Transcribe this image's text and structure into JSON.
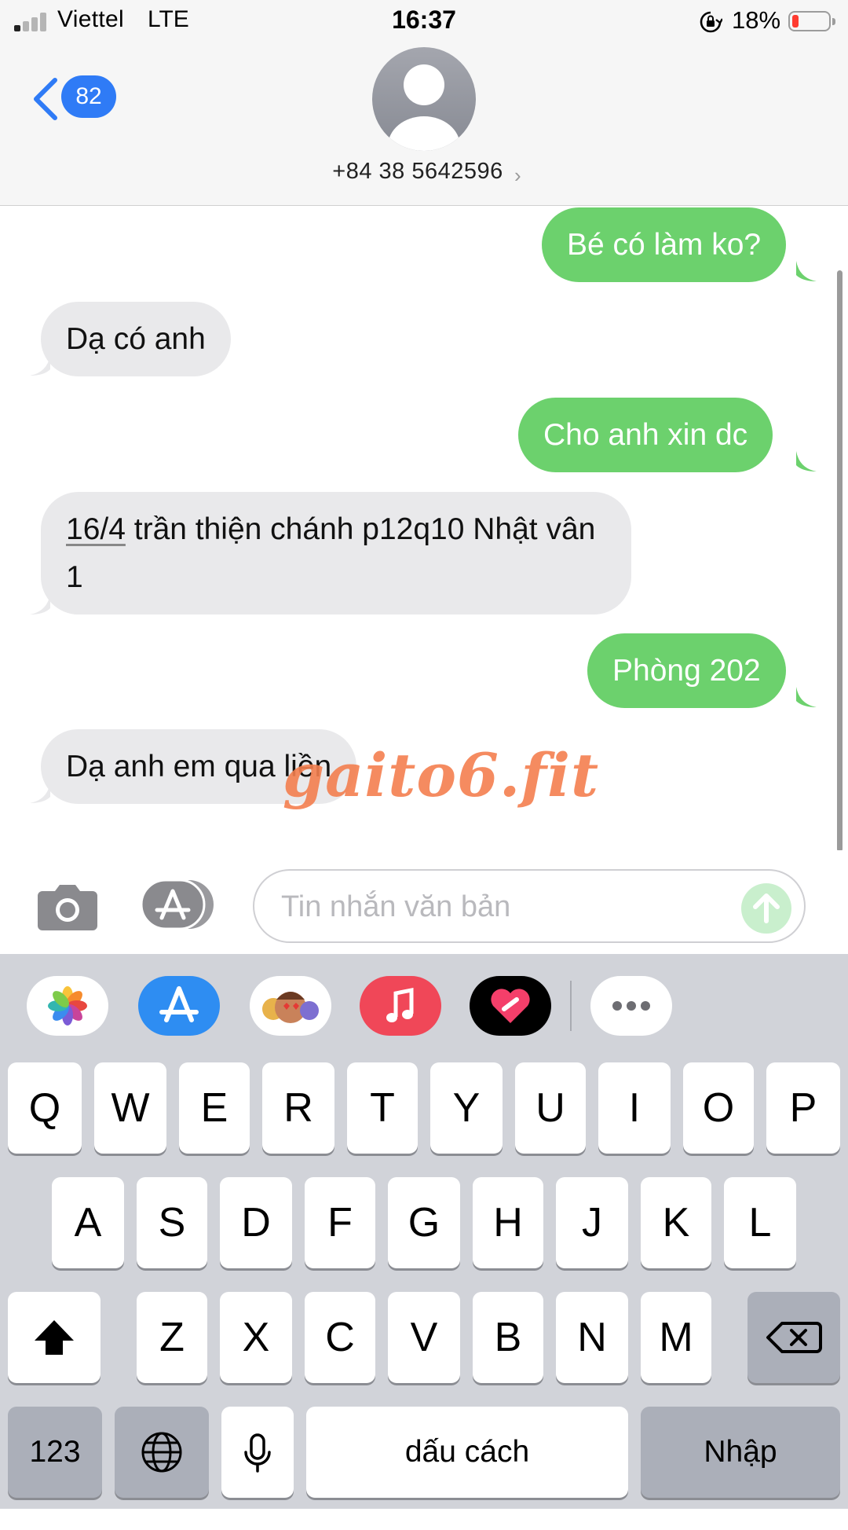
{
  "status_bar": {
    "carrier": "Viettel",
    "network": "LTE",
    "time": "16:37",
    "battery_percent": "18%",
    "colors": {
      "battery_low": "#ff3b30"
    }
  },
  "header": {
    "back_badge_count": "82",
    "contact_number": "+84 38 5642596",
    "icons": [
      "chevron-left-icon",
      "person-avatar-icon",
      "chevron-right-icon"
    ],
    "colors": {
      "accent": "#2f7bf6"
    }
  },
  "messages": [
    {
      "direction": "outgoing",
      "text": "Bé có làm ko?"
    },
    {
      "direction": "incoming",
      "text": "Dạ có anh"
    },
    {
      "direction": "outgoing",
      "text": "Cho anh xin dc"
    },
    {
      "direction": "incoming",
      "link_text": "16/4",
      "text": " trần thiện chánh p12q10 Nhật vân 1"
    },
    {
      "direction": "outgoing",
      "text": "Phòng 202"
    },
    {
      "direction": "incoming",
      "text": "Dạ anh em qua liền"
    }
  ],
  "message_colors": {
    "outgoing": "#6cd16d",
    "incoming": "#e9e9eb"
  },
  "watermark": "gaito6.fit",
  "compose": {
    "placeholder": "Tin nhắn văn bản",
    "value": "",
    "icons": [
      "camera-icon",
      "app-store-icon",
      "send-arrow-icon"
    ]
  },
  "app_strip": {
    "apps": [
      "photos-app-icon",
      "app-store-app-icon",
      "memoji-app-icon",
      "music-app-icon",
      "digital-touch-app-icon",
      "more-apps-icon"
    ]
  },
  "keyboard": {
    "row1": [
      "Q",
      "W",
      "E",
      "R",
      "T",
      "Y",
      "U",
      "I",
      "O",
      "P"
    ],
    "row2": [
      "A",
      "S",
      "D",
      "F",
      "G",
      "H",
      "J",
      "K",
      "L"
    ],
    "row3": [
      "Z",
      "X",
      "C",
      "V",
      "B",
      "N",
      "M"
    ],
    "numbers_key": "123",
    "space_key": "dấu cách",
    "return_key": "Nhập",
    "icons": [
      "shift-icon",
      "backspace-icon",
      "globe-icon",
      "microphone-icon"
    ]
  }
}
